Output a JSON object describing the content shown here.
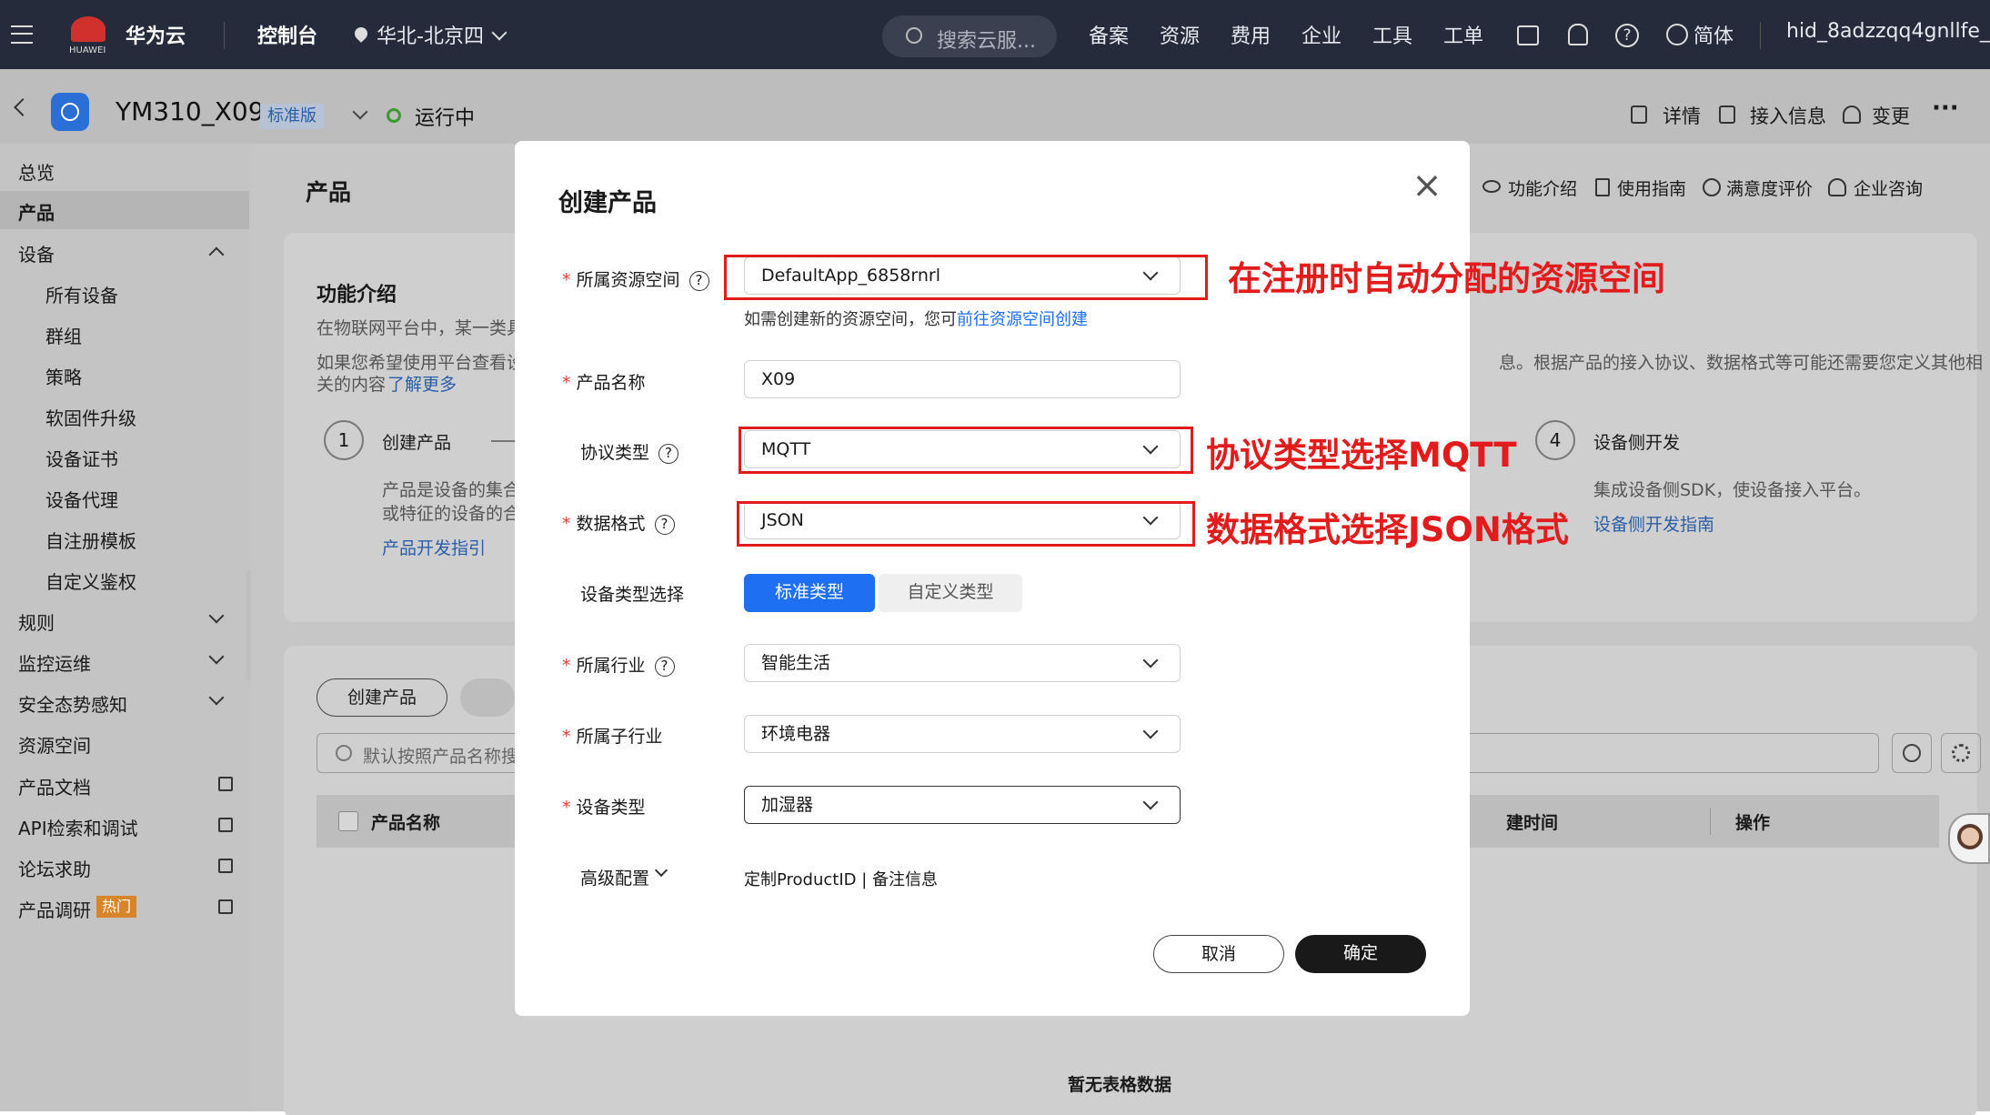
{
  "topbar": {
    "brand": "华为云",
    "brand_sub": "HUAWEI",
    "console": "控制台",
    "region": "华北-北京四",
    "search_placeholder": "搜索云服...",
    "menu": [
      "备案",
      "资源",
      "费用",
      "企业",
      "工具",
      "工单"
    ],
    "lang": "简体",
    "user": "hid_8adzzqq4gnllfe_"
  },
  "instance": {
    "name": "YM310_X09",
    "edition": "标准版",
    "status": "运行中",
    "actions": [
      "详情",
      "接入信息",
      "变更"
    ]
  },
  "sidebar": {
    "items": [
      "总览",
      "产品",
      "设备",
      "所有设备",
      "群组",
      "策略",
      "软固件升级",
      "设备证书",
      "设备代理",
      "自注册模板",
      "自定义鉴权",
      "规则",
      "监控运维",
      "安全态势感知",
      "资源空间",
      "产品文档",
      "API检索和调试",
      "论坛求助",
      "产品调研"
    ],
    "hot_badge": "热门"
  },
  "main": {
    "title": "产品",
    "toplinks": [
      "功能介绍",
      "使用指南",
      "满意度评价",
      "企业咨询"
    ],
    "intro_title": "功能介绍",
    "intro_l1": "在物联网平台中，某一类具",
    "intro_l2": "如果您希望使用平台查看设",
    "intro_l3": "关的内容",
    "intro_more": "了解更多",
    "intro_right": "息。根据产品的接入协议、数据格式等可能还需要您定义其他相",
    "step1_num": "1",
    "step1": "创建产品",
    "step1_d1": "产品是设备的集合",
    "step1_d2": "或特征的设备的合",
    "step1_link": "产品开发指引",
    "step4_num": "4",
    "step4": "设备侧开发",
    "step4_d": "集成设备侧SDK，使设备接入平台。",
    "step4_link": "设备侧开发指南",
    "create_btn": "创建产品",
    "search_placeholder": "默认按照产品名称搜",
    "col_name": "产品名称",
    "col_time": "建时间",
    "col_op": "操作",
    "empty": "暂无表格数据"
  },
  "modal": {
    "title": "创建产品",
    "f_space_label": "所属资源空间",
    "f_space_value": "DefaultApp_6858rnrl",
    "f_space_hint": "如需创建新的资源空间，您可",
    "f_space_link": "前往资源空间创建",
    "f_name_label": "产品名称",
    "f_name_value": "X09",
    "f_proto_label": "协议类型",
    "f_proto_value": "MQTT",
    "f_fmt_label": "数据格式",
    "f_fmt_value": "JSON",
    "f_devtype_label": "设备类型选择",
    "seg_standard": "标准类型",
    "seg_custom": "自定义类型",
    "f_industry_label": "所属行业",
    "f_industry_value": "智能生活",
    "f_subind_label": "所属子行业",
    "f_subind_value": "环境电器",
    "f_type_label": "设备类型",
    "f_type_value": "加湿器",
    "f_adv_label": "高级配置",
    "f_adv_value": "定制ProductID | 备注信息",
    "cancel": "取消",
    "ok": "确定"
  },
  "annotations": {
    "a1": "在注册时自动分配的资源空间",
    "a2": "协议类型选择MQTT",
    "a3": "数据格式选择JSON格式"
  },
  "colors": {
    "accent": "#1e6ff1",
    "annotation": "#e21c1c",
    "topbar": "#252b3a"
  }
}
